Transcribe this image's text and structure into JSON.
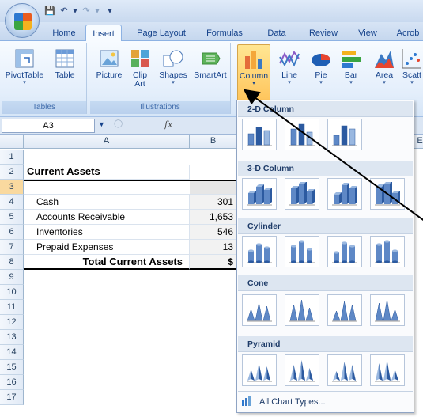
{
  "ribbon": {
    "tabs": [
      "Home",
      "Insert",
      "Page Layout",
      "Formulas",
      "Data",
      "Review",
      "View",
      "Acrob"
    ],
    "active_tab": "Insert",
    "groups": {
      "tables": {
        "label": "Tables",
        "buttons": [
          "PivotTable",
          "Table"
        ]
      },
      "illustrations": {
        "label": "Illustrations",
        "buttons": [
          "Picture",
          "Clip Art",
          "Shapes",
          "SmartArt"
        ]
      },
      "charts": {
        "buttons": [
          "Column",
          "Line",
          "Pie",
          "Bar",
          "Area",
          "Scatt"
        ]
      }
    }
  },
  "formula_bar": {
    "name_box": "A3",
    "fx_label": "fx"
  },
  "sheet": {
    "columns": [
      "A",
      "B",
      "E"
    ],
    "rows": [
      "1",
      "2",
      "3",
      "4",
      "5",
      "6",
      "7",
      "8",
      "9",
      "10",
      "11",
      "12",
      "13",
      "14",
      "15",
      "16",
      "17"
    ],
    "cells": {
      "A2": "Current Assets",
      "A4": "Cash",
      "A5": "Accounts Receivable",
      "A6": "Inventories",
      "A7": "Prepaid Expenses",
      "A8": "Total Current Assets",
      "B4": "301",
      "B5": "1,653",
      "B6": "546",
      "B7": "13",
      "B8": "$"
    }
  },
  "gallery": {
    "sections": [
      "2-D Column",
      "3-D Column",
      "Cylinder",
      "Cone",
      "Pyramid"
    ],
    "footer": "All Chart Types..."
  },
  "colors": {
    "accent": "#ffc55c",
    "ribbon": "#dbe6f4",
    "section_header": "#dde6f1"
  }
}
